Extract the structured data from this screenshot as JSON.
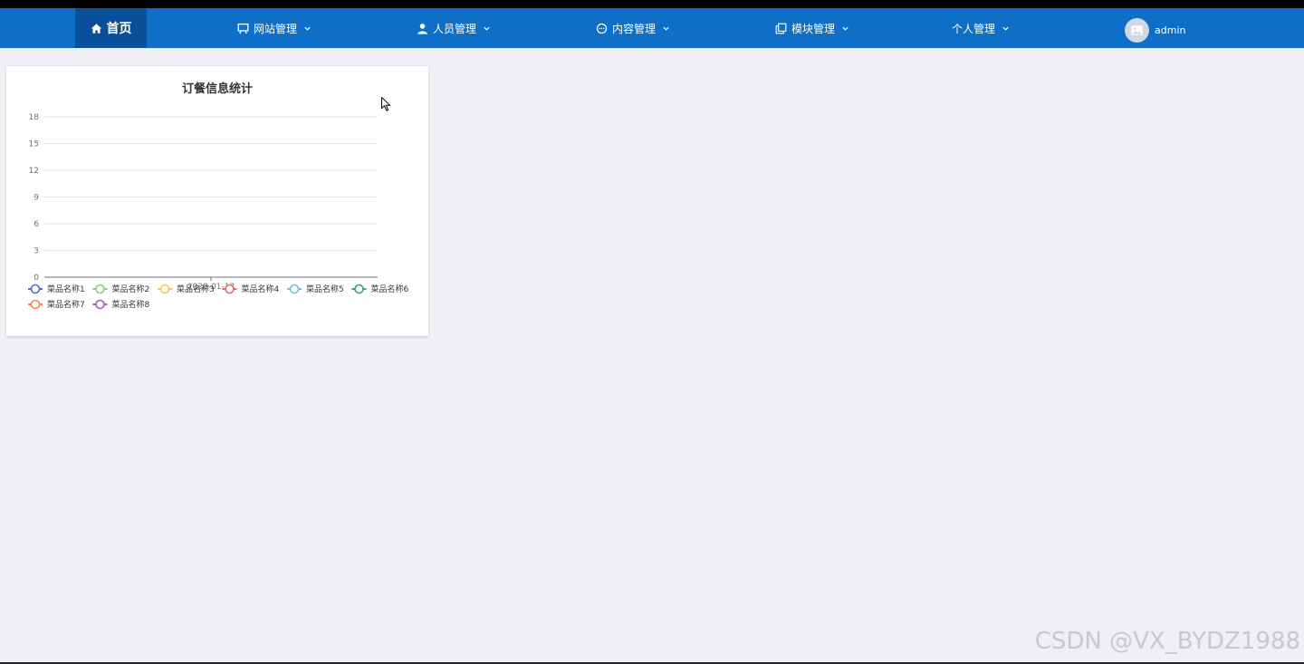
{
  "nav": {
    "home": {
      "label": "首页",
      "icon": "home-icon"
    },
    "items": [
      {
        "label": "网站管理",
        "icon": "presentation-icon"
      },
      {
        "label": "人员管理",
        "icon": "user-icon"
      },
      {
        "label": "内容管理",
        "icon": "chat-icon"
      },
      {
        "label": "模块管理",
        "icon": "copy-icon"
      },
      {
        "label": "个人管理",
        "icon": ""
      }
    ],
    "user": {
      "name": "admin",
      "avatar_icon": "image-icon"
    },
    "colors": {
      "bar": "#0f6fc6",
      "active": "#0a4f9a"
    }
  },
  "chart_data": {
    "type": "line",
    "title": "订餐信息统计",
    "x": [
      "2020-01-13"
    ],
    "ylim": [
      0,
      18
    ],
    "yticks": [
      0,
      3,
      6,
      9,
      12,
      15,
      18
    ],
    "grid": true,
    "legend_position": "bottom",
    "series": [
      {
        "name": "菜品名称1",
        "color": "#5470c6",
        "values": []
      },
      {
        "name": "菜品名称2",
        "color": "#91cc75",
        "values": []
      },
      {
        "name": "菜品名称3",
        "color": "#fac858",
        "values": []
      },
      {
        "name": "菜品名称4",
        "color": "#ee6666",
        "values": []
      },
      {
        "name": "菜品名称5",
        "color": "#73c0de",
        "values": []
      },
      {
        "name": "菜品名称6",
        "color": "#3ba272",
        "values": []
      },
      {
        "name": "菜品名称7",
        "color": "#fc8452",
        "values": []
      },
      {
        "name": "菜品名称8",
        "color": "#9a60b4",
        "values": []
      }
    ]
  },
  "watermark": "CSDN @VX_BYDZ1988"
}
